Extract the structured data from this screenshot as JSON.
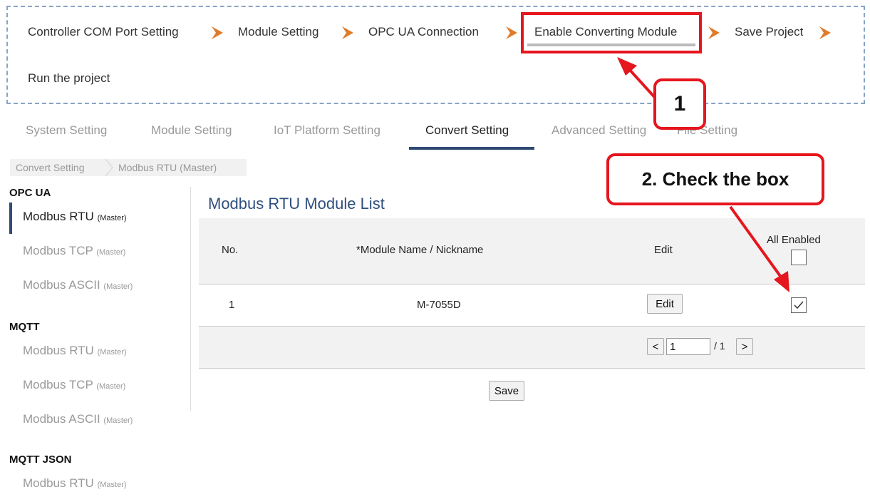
{
  "wizard": {
    "steps": [
      "Controller COM Port Setting",
      "Module Setting",
      "OPC UA Connection",
      "Enable Converting Module",
      "Save Project",
      "Run the project"
    ],
    "arrow_color": "#e07b2a"
  },
  "tabs": [
    "System Setting",
    "Module Setting",
    "IoT Platform Setting",
    "Convert Setting",
    "Advanced Setting",
    "File Setting"
  ],
  "active_tab": "Convert Setting",
  "breadcrumb": [
    "Convert Setting",
    "Modbus RTU (Master)"
  ],
  "sidebar": {
    "groups": [
      {
        "title": "OPC UA",
        "items": [
          {
            "name": "Modbus RTU",
            "suffix": "(Master)"
          },
          {
            "name": "Modbus TCP",
            "suffix": "(Master)"
          },
          {
            "name": "Modbus ASCII",
            "suffix": "(Master)"
          }
        ]
      },
      {
        "title": "MQTT",
        "items": [
          {
            "name": "Modbus RTU",
            "suffix": "(Master)"
          },
          {
            "name": "Modbus TCP",
            "suffix": "(Master)"
          },
          {
            "name": "Modbus ASCII",
            "suffix": "(Master)"
          }
        ]
      },
      {
        "title": "MQTT JSON",
        "items": [
          {
            "name": "Modbus RTU",
            "suffix": "(Master)"
          }
        ]
      }
    ]
  },
  "main": {
    "title": "Modbus RTU Module List",
    "columns": {
      "no": "No.",
      "name": "*Module Name / Nickname",
      "edit": "Edit",
      "enabled": "All Enabled"
    },
    "rows": [
      {
        "no": "1",
        "name": "M-7055D",
        "edit_label": "Edit",
        "enabled": true
      }
    ],
    "pager": {
      "prev": "<",
      "page": "1",
      "total": "/ 1",
      "next": ">"
    },
    "save_label": "Save"
  },
  "annotations": {
    "callout1": "1",
    "callout2": "2. Check the box",
    "color": "#e5161e"
  }
}
